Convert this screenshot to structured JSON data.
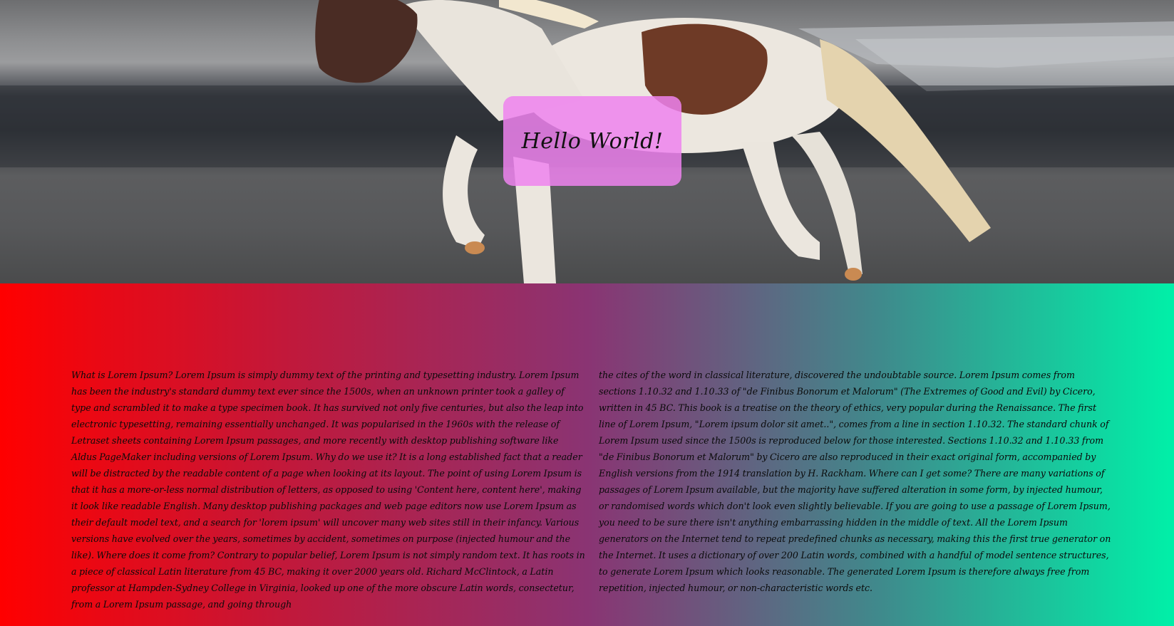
{
  "hero": {
    "card_text": "Hello World!",
    "card_color": "#ee82ee"
  },
  "content": {
    "gradient_start": "#ff0000",
    "gradient_end": "#00f0a8",
    "column_left": "What is Lorem Ipsum? Lorem Ipsum is simply dummy text of the printing and typesetting industry. Lorem Ipsum has been the industry's standard dummy text ever since the 1500s, when an unknown printer took a galley of type and scrambled it to make a type specimen book. It has survived not only five centuries, but also the leap into electronic typesetting, remaining essentially unchanged. It was popularised in the 1960s with the release of Letraset sheets containing Lorem Ipsum passages, and more recently with desktop publishing software like Aldus PageMaker including versions of Lorem Ipsum. Why do we use it? It is a long established fact that a reader will be distracted by the readable content of a page when looking at its layout. The point of using Lorem Ipsum is that it has a more-or-less normal distribution of letters, as opposed to using 'Content here, content here', making it look like readable English. Many desktop publishing packages and web page editors now use Lorem Ipsum as their default model text, and a search for 'lorem ipsum' will uncover many web sites still in their infancy. Various versions have evolved over the years, sometimes by accident, sometimes on purpose (injected humour and the like). Where does it come from? Contrary to popular belief, Lorem Ipsum is not simply random text. It has roots in a piece of classical Latin literature from 45 BC, making it over 2000 years old. Richard McClintock, a Latin professor at Hampden-Sydney College in Virginia, looked up one of the more obscure Latin words, consectetur, from a Lorem Ipsum passage, and going through",
    "column_right": "the cites of the word in classical literature, discovered the undoubtable source. Lorem Ipsum comes from sections 1.10.32 and 1.10.33 of \"de Finibus Bonorum et Malorum\" (The Extremes of Good and Evil) by Cicero, written in 45 BC. This book is a treatise on the theory of ethics, very popular during the Renaissance. The first line of Lorem Ipsum, \"Lorem ipsum dolor sit amet..\", comes from a line in section 1.10.32. The standard chunk of Lorem Ipsum used since the 1500s is reproduced below for those interested. Sections 1.10.32 and 1.10.33 from \"de Finibus Bonorum et Malorum\" by Cicero are also reproduced in their exact original form, accompanied by English versions from the 1914 translation by H. Rackham. Where can I get some? There are many variations of passages of Lorem Ipsum available, but the majority have suffered alteration in some form, by injected humour, or randomised words which don't look even slightly believable. If you are going to use a passage of Lorem Ipsum, you need to be sure there isn't anything embarrassing hidden in the middle of text. All the Lorem Ipsum generators on the Internet tend to repeat predefined chunks as necessary, making this the first true generator on the Internet. It uses a dictionary of over 200 Latin words, combined with a handful of model sentence structures, to generate Lorem Ipsum which looks reasonable. The generated Lorem Ipsum is therefore always free from repetition, injected humour, or non-characteristic words etc."
  }
}
